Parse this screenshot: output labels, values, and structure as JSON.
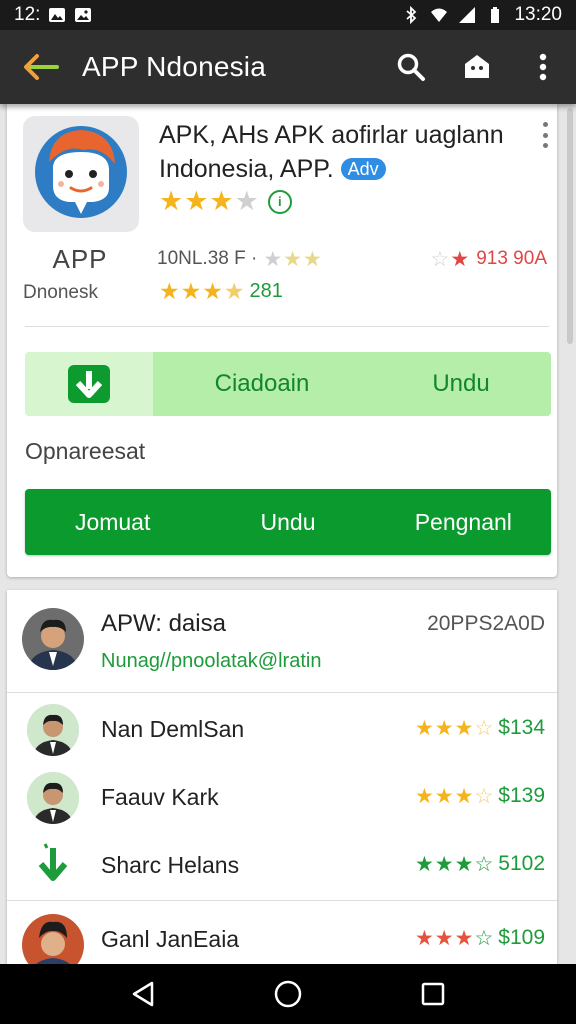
{
  "status_bar": {
    "time_left": "12:",
    "time_right": "13:20"
  },
  "toolbar": {
    "title": "APP Ndonesia"
  },
  "app": {
    "title": "APK, AHs APK aofirlar uaglann Indonesia, APP.",
    "ad_badge": "Adv",
    "rating_stars": 3,
    "developer_logo_text": "APP",
    "developer_name": "Dnonesk",
    "meta_code": "10NL.38 F ·",
    "meta_right_value": "913 90A",
    "rating_count": "281"
  },
  "download_bar": {
    "label_left": "Ciadoain",
    "label_right": "Undu"
  },
  "section": {
    "label": "Opnareesat"
  },
  "action_bar": {
    "items": [
      "Jomuat",
      "Undu",
      "Pengnanl"
    ]
  },
  "featured": {
    "title": "APW: daisa",
    "subtitle": "Nunag//pnoolatak@lratin",
    "right": "20PPS2A0D"
  },
  "list": [
    {
      "name": "Nan DemlSan",
      "price": "$134",
      "stars": 3,
      "star_color": "#f5b41b",
      "price_color": "#1e9b3b"
    },
    {
      "name": "Faauv Kark",
      "price": "$139",
      "stars": 3,
      "star_color": "#f5b41b",
      "price_color": "#1e9b3b"
    },
    {
      "name": "Sharc Helans",
      "price": "5102",
      "stars": 3,
      "star_color": "#1e9b3b",
      "price_color": "#1e9b3b"
    },
    {
      "name": "Ganl JanEaia",
      "price": "$109",
      "stars": 3,
      "star_color": "#e5533c",
      "price_color": "#1e9b3b"
    }
  ],
  "colors": {
    "accent_green": "#0b9a2e",
    "toolbar": "#2e2e2e",
    "ad_blue": "#2f8de4",
    "star": "#f5b41b"
  },
  "icons": [
    "back-arrow-icon",
    "search-icon",
    "store-icon",
    "overflow-menu-icon",
    "download-icon",
    "info-icon",
    "back-nav-icon",
    "home-nav-icon",
    "recents-nav-icon"
  ]
}
